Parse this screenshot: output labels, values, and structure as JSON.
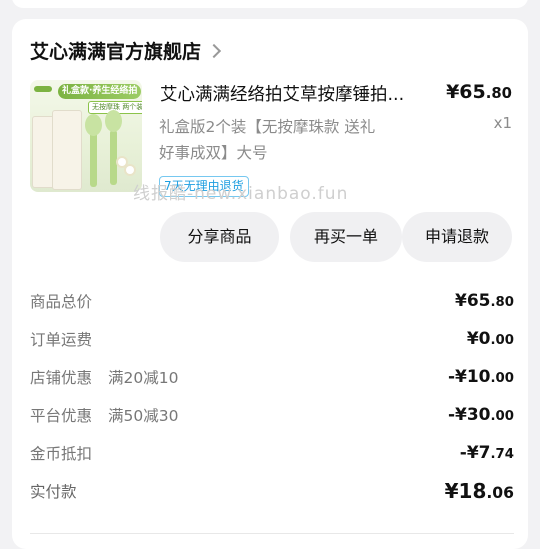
{
  "shop": {
    "name": "艾心满满官方旗舰店"
  },
  "product": {
    "title": "艾心满满经络拍艾草按摩锤拍...",
    "price": {
      "symbol": "¥",
      "int": "65",
      "dec": ".80"
    },
    "spec_line1": "礼盒版2个装【无按摩珠款 送礼",
    "spec_line2": "好事成双】大号",
    "quantity": "x1",
    "service_badge": "7天无理由退货",
    "image_banner": "礼盒款·养生经络拍",
    "image_tag": "无按摩珠 两个装"
  },
  "watermark": "线报酷-new.xianbao.fun",
  "actions": {
    "share": "分享商品",
    "rebuy": "再买一单",
    "refund": "申请退款"
  },
  "summary": {
    "items_total": {
      "label": "商品总价",
      "sign": "",
      "symbol": "¥",
      "int": "65",
      "dec": ".80"
    },
    "shipping": {
      "label": "订单运费",
      "sign": "",
      "symbol": "¥",
      "int": "0",
      "dec": ".00"
    },
    "shop_discount": {
      "label": "店铺优惠",
      "note": "满20减10",
      "sign": "-",
      "symbol": "¥",
      "int": "10",
      "dec": ".00"
    },
    "platform_discount": {
      "label": "平台优惠",
      "note": "满50减30",
      "sign": "-",
      "symbol": "¥",
      "int": "30",
      "dec": ".00"
    },
    "coins": {
      "label": "金币抵扣",
      "sign": "-",
      "symbol": "¥",
      "int": "7",
      "dec": ".74"
    },
    "paid": {
      "label": "实付款",
      "sign": "",
      "symbol": "¥",
      "int": "18",
      "dec": ".06"
    }
  },
  "colors": {
    "badge_blue": "#1e9ee0",
    "card_bg": "#ffffff",
    "page_bg": "#f2f2f4"
  }
}
